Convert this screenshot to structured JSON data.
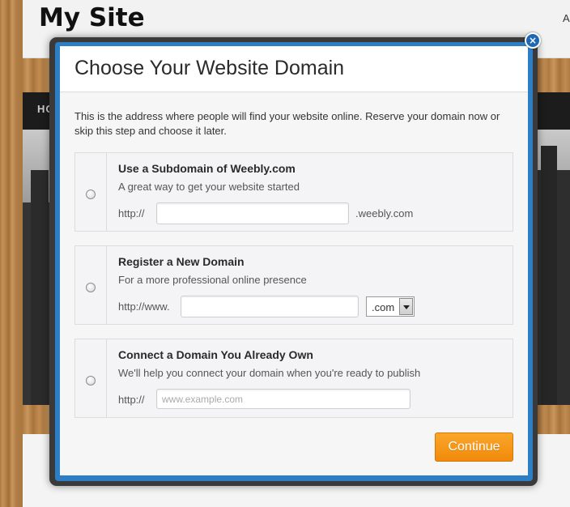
{
  "site": {
    "title": "My Site",
    "nav_letter": "A",
    "nav_home_partial": "HO"
  },
  "modal": {
    "title": "Choose Your Website Domain",
    "description": "This is the address where people will find your website online. Reserve your domain now or skip this step and choose it later.",
    "close_label": "×",
    "options": [
      {
        "title": "Use a Subdomain of Weebly.com",
        "subtitle": "A great way to get your website started",
        "prefix": "http://",
        "input_value": "",
        "input_placeholder": "",
        "suffix": ".weebly.com",
        "selected": false
      },
      {
        "title": "Register a New Domain",
        "subtitle": "For a more professional online presence",
        "prefix": "http://www.",
        "input_value": "",
        "input_placeholder": "",
        "tld_selected": ".com",
        "selected": false
      },
      {
        "title": "Connect a Domain You Already Own",
        "subtitle": "We'll help you connect your domain when you're ready to publish",
        "prefix": "http://",
        "input_value": "",
        "input_placeholder": "www.example.com",
        "selected": false
      }
    ],
    "continue_label": "Continue"
  },
  "colors": {
    "modal_border_blue": "#2d7fc5",
    "continue_orange": "#f39414",
    "close_button_blue": "#1e69b3"
  }
}
